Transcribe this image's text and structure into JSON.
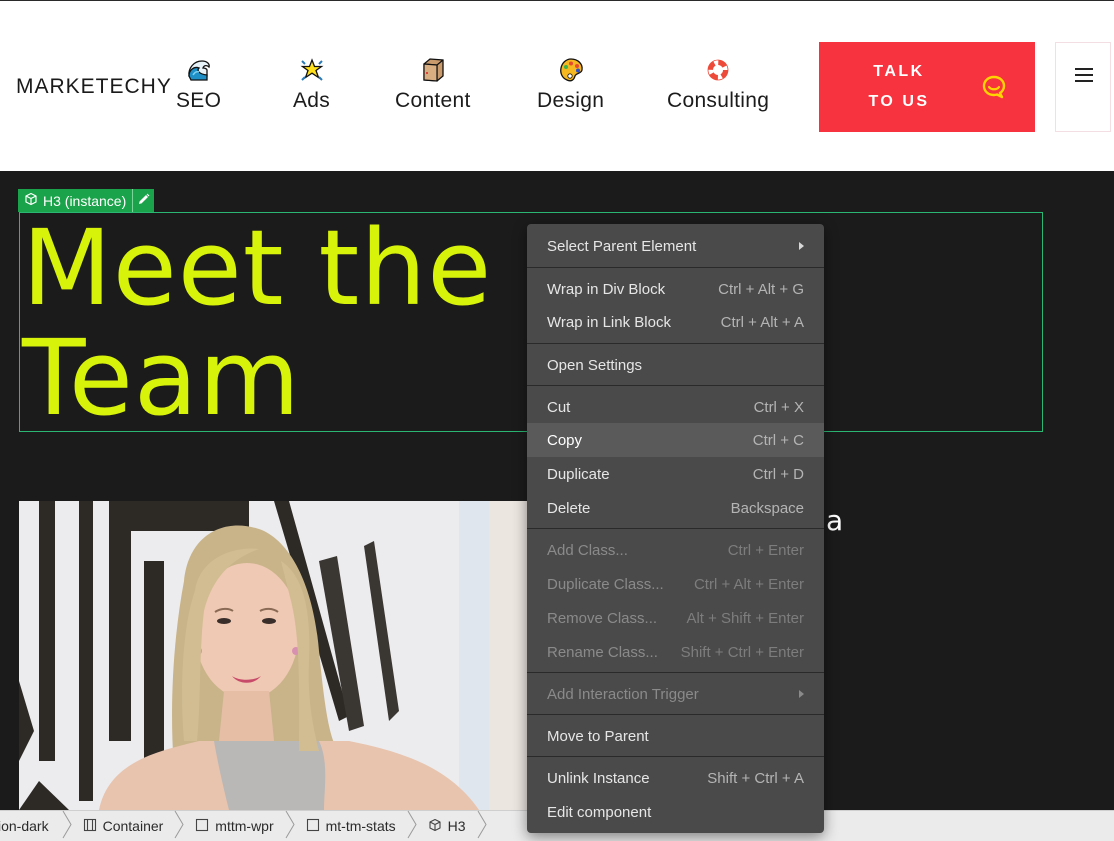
{
  "header": {
    "logo": "MARKETECHY",
    "nav": [
      {
        "label": "SEO",
        "icon": "wave-icon"
      },
      {
        "label": "Ads",
        "icon": "sparkle-star-icon"
      },
      {
        "label": "Content",
        "icon": "package-box-icon"
      },
      {
        "label": "Design",
        "icon": "palette-icon"
      },
      {
        "label": "Consulting",
        "icon": "lifebuoy-icon"
      }
    ],
    "cta": {
      "line1": "TALK",
      "line2": "TO US",
      "icon": "chat-bubble-icon"
    },
    "menu_icon": "hamburger-icon"
  },
  "canvas": {
    "selection_badge": "H3 (instance)",
    "heading_line1": "Meet the",
    "heading_line2": "Team",
    "partial_text": "a"
  },
  "colors": {
    "accent_heading": "#d8f30a",
    "cta_bg": "#f6333f",
    "selection": "#1aa34a",
    "menu_bg": "#4a4a4a"
  },
  "context_menu": {
    "items": [
      {
        "label": "Select Parent Element",
        "shortcut": "",
        "submenu": true,
        "disabled": false
      },
      {
        "label": "Wrap in Div Block",
        "shortcut": "Ctrl + Alt + G",
        "disabled": false
      },
      {
        "label": "Wrap in Link Block",
        "shortcut": "Ctrl + Alt + A",
        "disabled": false
      },
      {
        "label": "Open Settings",
        "shortcut": "",
        "disabled": false
      },
      {
        "label": "Cut",
        "shortcut": "Ctrl + X",
        "disabled": false
      },
      {
        "label": "Copy",
        "shortcut": "Ctrl + C",
        "disabled": false,
        "hovered": true
      },
      {
        "label": "Duplicate",
        "shortcut": "Ctrl + D",
        "disabled": false
      },
      {
        "label": "Delete",
        "shortcut": "Backspace",
        "disabled": false
      },
      {
        "label": "Add Class...",
        "shortcut": "Ctrl + Enter",
        "disabled": true
      },
      {
        "label": "Duplicate Class...",
        "shortcut": "Ctrl + Alt + Enter",
        "disabled": true
      },
      {
        "label": "Remove Class...",
        "shortcut": "Alt + Shift + Enter",
        "disabled": true
      },
      {
        "label": "Rename Class...",
        "shortcut": "Shift + Ctrl + Enter",
        "disabled": true
      },
      {
        "label": "Add Interaction Trigger",
        "shortcut": "",
        "submenu": true,
        "disabled": true
      },
      {
        "label": "Move to Parent",
        "shortcut": "",
        "disabled": false
      },
      {
        "label": "Unlink Instance",
        "shortcut": "Shift + Ctrl + A",
        "disabled": false
      },
      {
        "label": "Edit component",
        "shortcut": "",
        "disabled": false
      }
    ]
  },
  "breadcrumb": [
    {
      "label": "ion-dark",
      "icon": ""
    },
    {
      "label": "Container",
      "icon": "container-icon"
    },
    {
      "label": "mttm-wpr",
      "icon": "div-block-icon"
    },
    {
      "label": "mt-tm-stats",
      "icon": "div-block-icon"
    },
    {
      "label": "H3",
      "icon": "component-cube-icon"
    }
  ]
}
